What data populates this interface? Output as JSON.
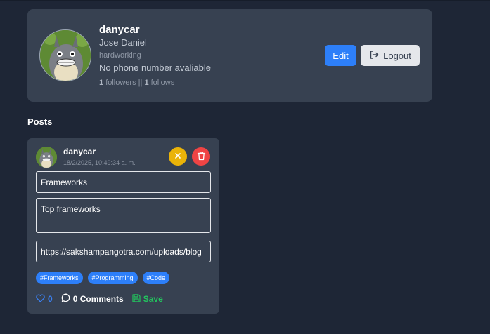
{
  "profile": {
    "username": "danycar",
    "full_name": "Jose Daniel",
    "bio": "hardworking",
    "phone": "No phone number avaliable",
    "followers_count": "1",
    "followers_label": "followers",
    "separator": "||",
    "follows_count": "1",
    "follows_label": "follows",
    "edit_label": "Edit",
    "logout_label": "Logout"
  },
  "posts_section": {
    "title": "Posts"
  },
  "post": {
    "username": "danycar",
    "date": "18/2/2025, 10:49:34 a. m.",
    "title_value": "Frameworks",
    "description_value": "Top frameworks",
    "url_value": "https://sakshampangotra.com/uploads/blog",
    "tags": [
      "#Frameworks",
      "#Programming",
      "#Code"
    ],
    "likes": "0",
    "comments_label": "0 Comments",
    "save_label": "Save"
  },
  "colors": {
    "background": "#1e2636",
    "card": "#374151",
    "primary": "#2d7ff9",
    "warning": "#eab308",
    "danger": "#ef4444",
    "success": "#22c55e"
  },
  "icons": {
    "logout": "logout-icon",
    "cancel": "close-icon",
    "delete": "trash-icon",
    "like": "heart-icon",
    "comments": "comment-icon",
    "save": "floppy-disk-icon"
  }
}
